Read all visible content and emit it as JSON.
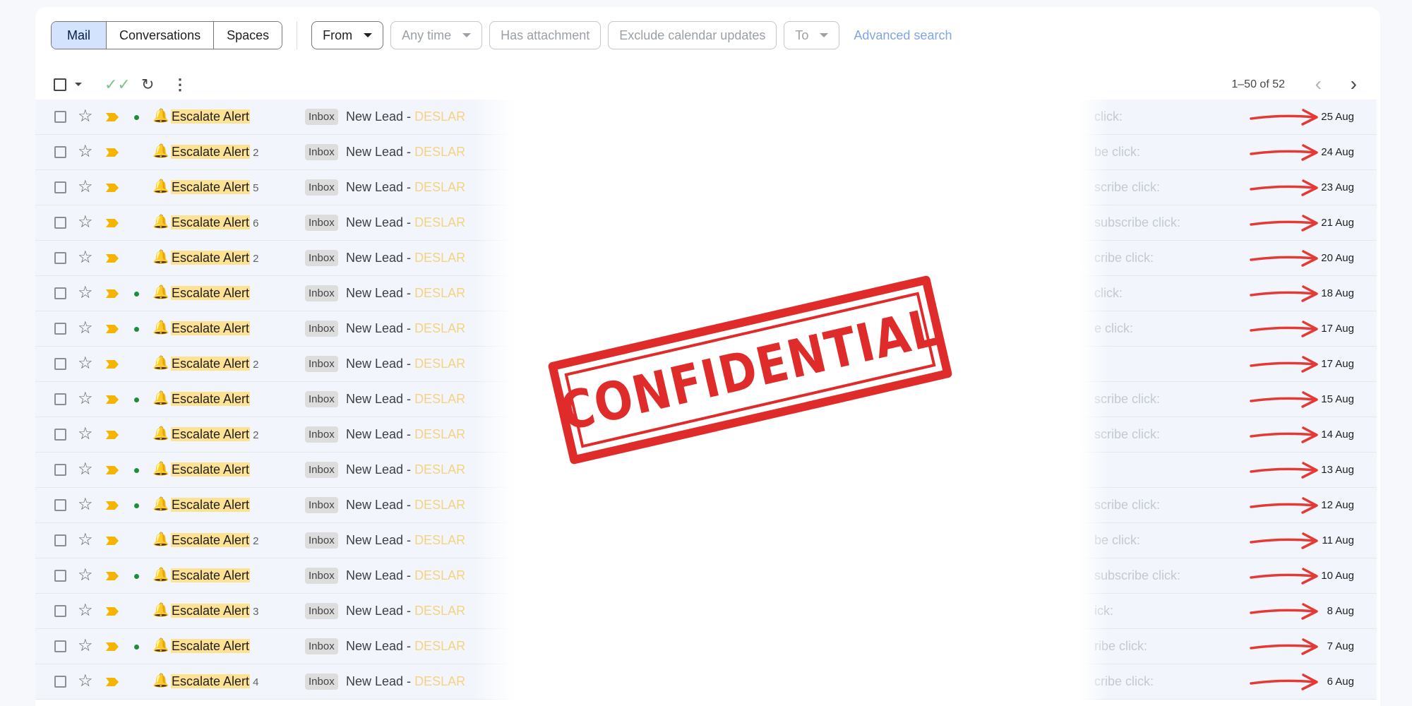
{
  "filters": {
    "segments": [
      {
        "label": "Mail",
        "active": true
      },
      {
        "label": "Conversations",
        "active": false
      },
      {
        "label": "Spaces",
        "active": false
      }
    ],
    "from_label": "From",
    "any_time_label": "Any time",
    "has_attachment_label": "Has attachment",
    "exclude_calendar_label": "Exclude calendar updates",
    "to_label": "To",
    "advanced_search_label": "Advanced search"
  },
  "toolbar": {
    "count_text": "1–50 of 52"
  },
  "rows": [
    {
      "sender": "Escalate Alert",
      "count": "",
      "unread_dot": true,
      "label": "Inbox",
      "subject_prefix": "New Lead - ",
      "subject_brand": "DESLAR",
      "tail": "click:",
      "date": "25 Aug"
    },
    {
      "sender": "Escalate Alert",
      "count": "2",
      "unread_dot": false,
      "label": "Inbox",
      "subject_prefix": "New Lead - ",
      "subject_brand": "DESLAR",
      "tail": "be click:",
      "date": "24 Aug"
    },
    {
      "sender": "Escalate Alert",
      "count": "5",
      "unread_dot": false,
      "label": "Inbox",
      "subject_prefix": "New Lead - ",
      "subject_brand": "DESLAR",
      "tail": "scribe click:",
      "date": "23 Aug"
    },
    {
      "sender": "Escalate Alert",
      "count": "6",
      "unread_dot": false,
      "label": "Inbox",
      "subject_prefix": "New Lead - ",
      "subject_brand": "DESLAR",
      "tail": "subscribe click:",
      "date": "21 Aug"
    },
    {
      "sender": "Escalate Alert",
      "count": "2",
      "unread_dot": false,
      "label": "Inbox",
      "subject_prefix": "New Lead - ",
      "subject_brand": "DESLAR",
      "tail": "cribe click:",
      "date": "20 Aug"
    },
    {
      "sender": "Escalate Alert",
      "count": "",
      "unread_dot": true,
      "label": "Inbox",
      "subject_prefix": "New Lead - ",
      "subject_brand": "DESLAR",
      "tail": "click:",
      "date": "18 Aug"
    },
    {
      "sender": "Escalate Alert",
      "count": "",
      "unread_dot": true,
      "label": "Inbox",
      "subject_prefix": "New Lead - ",
      "subject_brand": "DESLAR",
      "tail": "e click:",
      "date": "17 Aug"
    },
    {
      "sender": "Escalate Alert",
      "count": "2",
      "unread_dot": false,
      "label": "Inbox",
      "subject_prefix": "New Lead - ",
      "subject_brand": "DESLAR",
      "tail": "",
      "date": "17 Aug"
    },
    {
      "sender": "Escalate Alert",
      "count": "",
      "unread_dot": true,
      "label": "Inbox",
      "subject_prefix": "New Lead - ",
      "subject_brand": "DESLAR",
      "tail": "scribe click:",
      "date": "15 Aug"
    },
    {
      "sender": "Escalate Alert",
      "count": "2",
      "unread_dot": false,
      "label": "Inbox",
      "subject_prefix": "New Lead - ",
      "subject_brand": "DESLAR",
      "tail": "scribe click:",
      "date": "14 Aug"
    },
    {
      "sender": "Escalate Alert",
      "count": "",
      "unread_dot": true,
      "label": "Inbox",
      "subject_prefix": "New Lead - ",
      "subject_brand": "DESLAR",
      "tail": "",
      "date": "13 Aug"
    },
    {
      "sender": "Escalate Alert",
      "count": "",
      "unread_dot": true,
      "label": "Inbox",
      "subject_prefix": "New Lead - ",
      "subject_brand": "DESLAR",
      "tail": "scribe click:",
      "date": "12 Aug"
    },
    {
      "sender": "Escalate Alert",
      "count": "2",
      "unread_dot": false,
      "label": "Inbox",
      "subject_prefix": "New Lead - ",
      "subject_brand": "DESLAR",
      "tail": "be click:",
      "date": "11 Aug"
    },
    {
      "sender": "Escalate Alert",
      "count": "",
      "unread_dot": true,
      "label": "Inbox",
      "subject_prefix": "New Lead - ",
      "subject_brand": "DESLAR",
      "tail": "subscribe click:",
      "date": "10 Aug"
    },
    {
      "sender": "Escalate Alert",
      "count": "3",
      "unread_dot": false,
      "label": "Inbox",
      "subject_prefix": "New Lead - ",
      "subject_brand": "DESLAR",
      "tail": "ick:",
      "date": "8 Aug"
    },
    {
      "sender": "Escalate Alert",
      "count": "",
      "unread_dot": true,
      "label": "Inbox",
      "subject_prefix": "New Lead - ",
      "subject_brand": "DESLAR",
      "tail": "ribe click:",
      "date": "7 Aug"
    },
    {
      "sender": "Escalate Alert",
      "count": "4",
      "unread_dot": false,
      "label": "Inbox",
      "subject_prefix": "New Lead - ",
      "subject_brand": "DESLAR",
      "tail": "cribe click:",
      "date": "6 Aug"
    }
  ],
  "stamp": {
    "text": "CONFIDENTIAL",
    "color": "#e02b2b"
  },
  "colors": {
    "accent_active": "#d3e3fd",
    "highlight": "#fde293",
    "importance": "#f4b400",
    "unread_dot": "#1e8e3e",
    "arrow": "#e53935"
  }
}
